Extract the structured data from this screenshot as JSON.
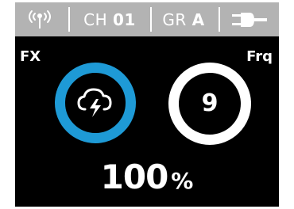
{
  "status_bar": {
    "wireless_icon": "wireless-signal-icon",
    "channel_label": "CH",
    "channel_value": "01",
    "group_label": "GR",
    "group_value": "A",
    "power_icon": "power-plug-icon"
  },
  "fx_label": "FX",
  "frq_label": "Frq",
  "fx_icon": "cloud-lightning-icon",
  "frq_value": "9",
  "output_value": "100",
  "output_unit": "%",
  "colors": {
    "status_bar_bg": "#b3b3b3",
    "screen_bg": "#000000",
    "fx_ring": "#1e9ad6",
    "frq_ring": "#ffffff"
  }
}
